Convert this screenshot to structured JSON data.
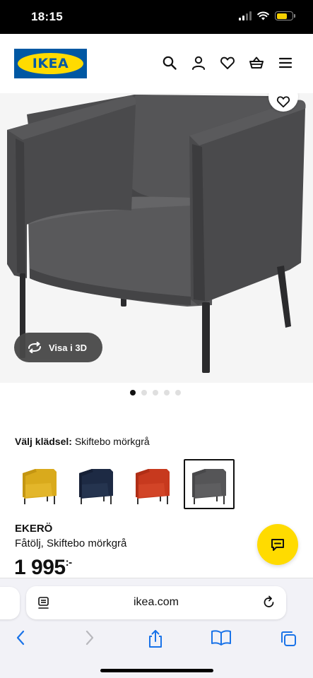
{
  "status_bar": {
    "time": "18:15",
    "battery_color": "#f5d000"
  },
  "header": {
    "logo_text": "IKEA",
    "brand_blue": "#0058a3",
    "brand_yellow": "#ffdb00",
    "icons": [
      "search-icon",
      "user-icon",
      "heart-icon",
      "basket-icon",
      "menu-icon"
    ]
  },
  "gallery": {
    "view_3d_label": "Visa i 3D",
    "dots": [
      true,
      false,
      false,
      false,
      false
    ]
  },
  "upholstery": {
    "label": "Välj klädsel:",
    "value": "Skiftebo mörkgrå",
    "swatches": [
      {
        "color": "#d9aa1c",
        "selected": false
      },
      {
        "color": "#1d2a44",
        "selected": false
      },
      {
        "color": "#c7391e",
        "selected": false
      },
      {
        "color": "#555557",
        "selected": true
      }
    ]
  },
  "product": {
    "name": "EKERÖ",
    "description": "Fåtölj, Skiftebo mörkgrå",
    "price": "1 995",
    "price_suffix": ":-"
  },
  "browser": {
    "url": "ikea.com"
  }
}
